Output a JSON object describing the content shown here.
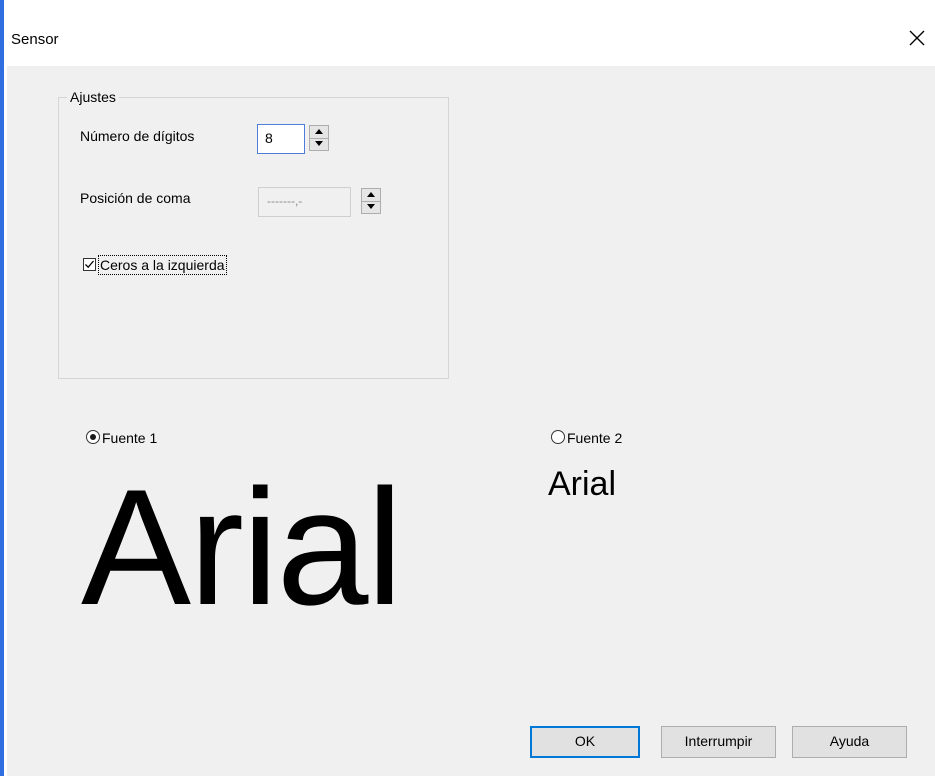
{
  "window": {
    "title": "Sensor",
    "close_icon": "close-icon",
    "accent_color": "#2f6fe0"
  },
  "settings": {
    "group_label": "Ajustes",
    "digits": {
      "label": "Número de dígitos",
      "value": "8"
    },
    "comma_position": {
      "label": "Posición de coma",
      "value": "-------,-",
      "enabled": false
    },
    "leading_zeros": {
      "label": "Ceros a la izquierda",
      "checked": true
    }
  },
  "fonts": {
    "font1": {
      "label": "Fuente 1",
      "selected": true,
      "preview": "Arial"
    },
    "font2": {
      "label": "Fuente 2",
      "selected": false,
      "preview": "Arial"
    }
  },
  "buttons": {
    "ok": "OK",
    "cancel": "Interrumpir",
    "help": "Ayuda"
  }
}
